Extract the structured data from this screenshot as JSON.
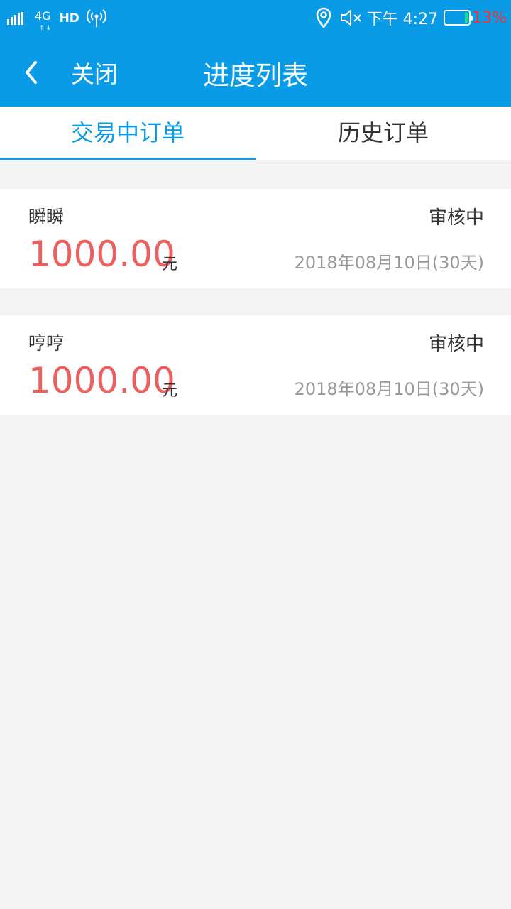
{
  "status_bar": {
    "network": "4G",
    "hd": "HD",
    "time": "下午 4:27",
    "battery_percent": "13%",
    "battery_level": 0.13,
    "icons": [
      "signal-icon",
      "hotspot-icon",
      "location-icon",
      "mute-icon",
      "battery-icon"
    ]
  },
  "header": {
    "close_label": "关闭",
    "title": "进度列表"
  },
  "tabs": [
    {
      "label": "交易中订单",
      "active": true
    },
    {
      "label": "历史订单",
      "active": false
    }
  ],
  "orders": [
    {
      "name": "瞬瞬",
      "status": "审核中",
      "amount": "1000.00",
      "unit": "元",
      "date": "2018年08月10日(30天)"
    },
    {
      "name": "哼哼",
      "status": "审核中",
      "amount": "1000.00",
      "unit": "元",
      "date": "2018年08月10日(30天)"
    }
  ],
  "colors": {
    "brand": "#0a9be6",
    "amount": "#ec5f5f",
    "background": "#f3f3f3"
  }
}
